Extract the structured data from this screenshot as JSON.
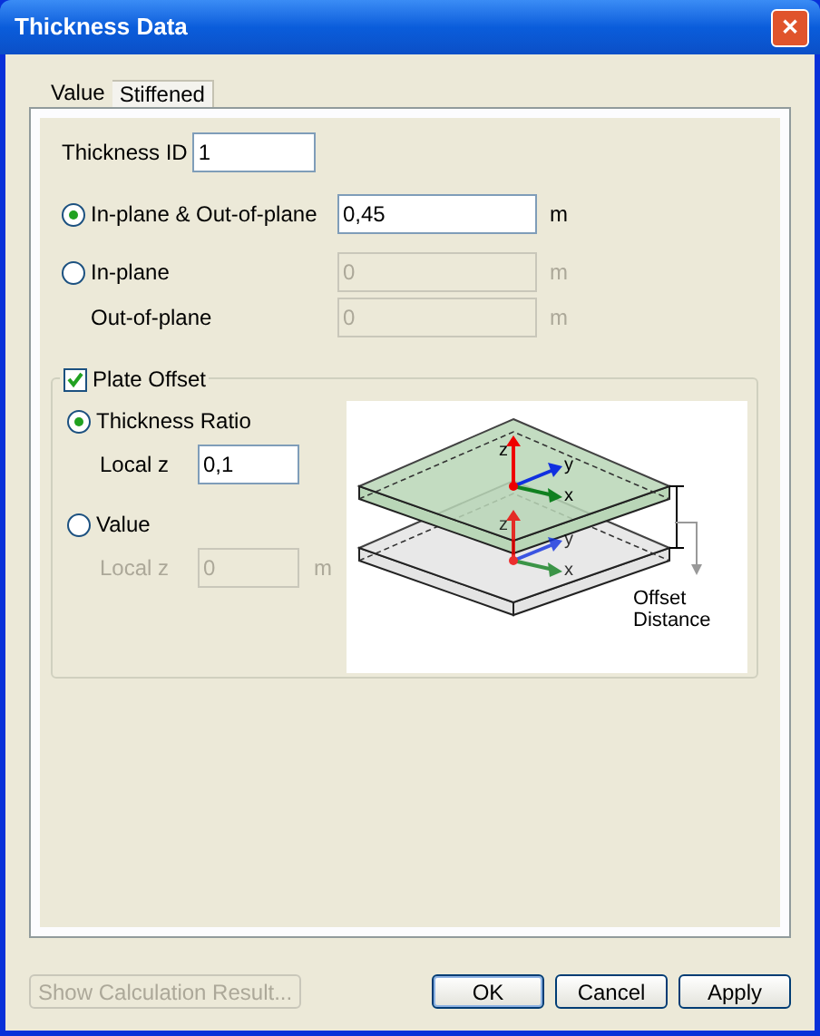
{
  "window": {
    "title": "Thickness Data",
    "close": "✕"
  },
  "tabs": [
    {
      "label": "Value",
      "selected": true
    },
    {
      "label": "Stiffened",
      "selected": false
    }
  ],
  "thickness_id": {
    "label": "Thickness ID",
    "value": "1"
  },
  "thickness_options": [
    {
      "label": "In-plane & Out-of-plane",
      "selected": true,
      "value": "0,45",
      "unit": "m",
      "disabled": false
    },
    {
      "label": "In-plane",
      "selected": false,
      "value": "0",
      "unit": "m",
      "disabled": true
    }
  ],
  "out_of_plane": {
    "label": "Out-of-plane",
    "value": "0",
    "unit": "m",
    "disabled": true
  },
  "plate_offset": {
    "label": "Plate Offset",
    "checked": true,
    "options": [
      {
        "label": "Thickness Ratio",
        "selected": true,
        "field_label": "Local z",
        "value": "0,1",
        "disabled": false
      },
      {
        "label": "Value",
        "selected": false,
        "field_label": "Local z",
        "value": "0",
        "unit": "m",
        "disabled": true
      }
    ],
    "diagram": {
      "axis_labels_top": [
        "z",
        "y",
        "x"
      ],
      "axis_labels_bottom": [
        "z",
        "y",
        "x"
      ],
      "caption": [
        "Offset",
        "Distance"
      ]
    }
  },
  "footer": {
    "calc_button": {
      "label": "Show Calculation Result...",
      "disabled": true
    },
    "buttons": [
      {
        "label": "OK",
        "default": true
      },
      {
        "label": "Cancel",
        "default": false
      },
      {
        "label": "Apply",
        "default": false
      }
    ]
  }
}
